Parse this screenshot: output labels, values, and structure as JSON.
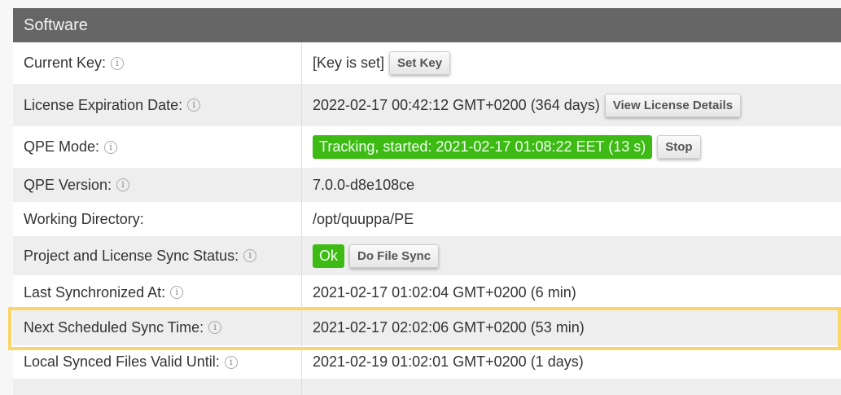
{
  "section_title": "Software",
  "info_glyph": "i",
  "rows": [
    {
      "label": "Current Key:",
      "value": "[Key is set]",
      "button": "Set Key"
    },
    {
      "label": "License Expiration Date:",
      "value": "2022-02-17 00:42:12 GMT+0200 (364 days)",
      "button": "View License Details"
    },
    {
      "label": "QPE Mode:",
      "badge": "Tracking, started: 2021-02-17 01:08:22 EET (13 s)",
      "button": "Stop"
    },
    {
      "label": "QPE Version:",
      "value": "7.0.0-d8e108ce"
    },
    {
      "label": "Working Directory:",
      "value": "/opt/quuppa/PE"
    },
    {
      "label": "Project and License Sync Status:",
      "badge": "Ok",
      "button": "Do File Sync"
    },
    {
      "label": "Last Synchronized At:",
      "value": "2021-02-17 01:02:04 GMT+0200 (6 min)"
    },
    {
      "label": "Next Scheduled Sync Time:",
      "value": "2021-02-17 02:02:06 GMT+0200 (53 min)"
    },
    {
      "label": "Local Synced Files Valid Until:",
      "value": "2021-02-19 01:02:01 GMT+0200 (1 days)"
    }
  ],
  "colors": {
    "header": "#666666",
    "status_ok": "#3dbb14",
    "highlight": "#f9d66a"
  }
}
